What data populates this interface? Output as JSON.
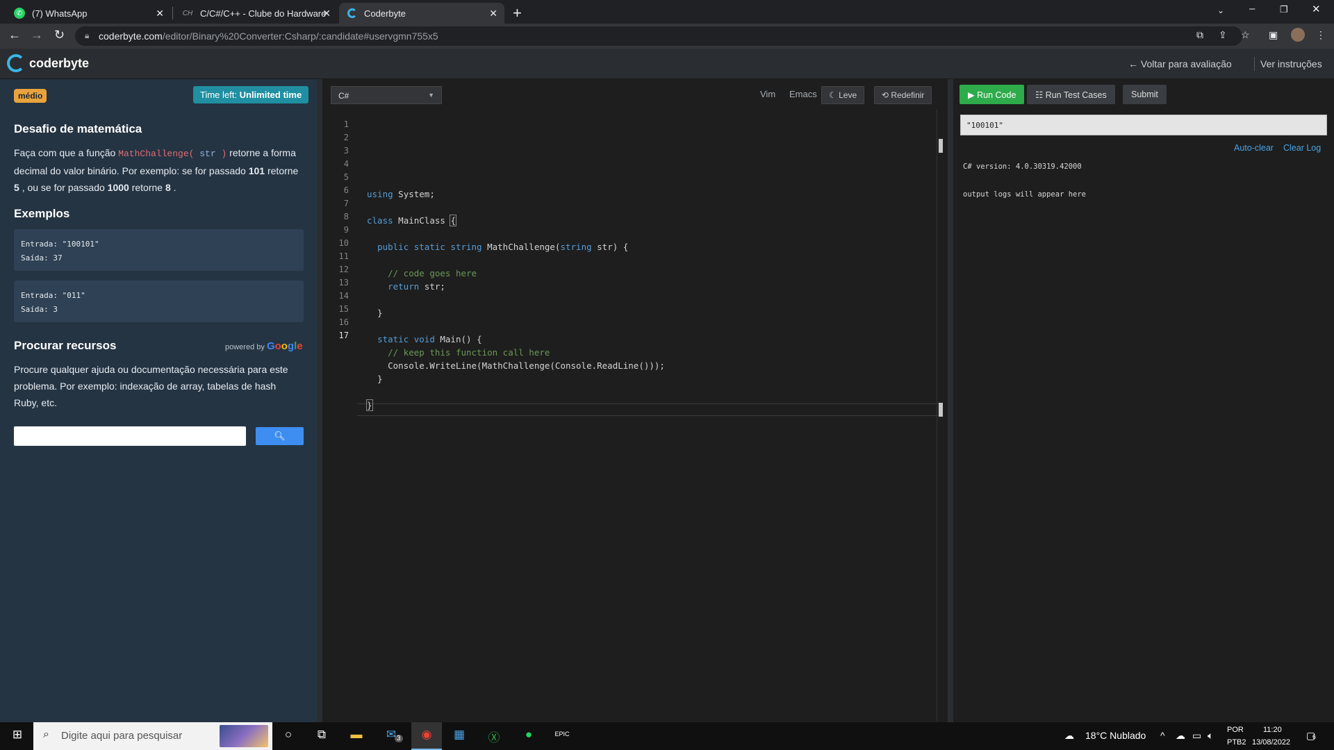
{
  "browser": {
    "tabs": [
      {
        "label": "(7) WhatsApp",
        "icon": "whatsapp-icon",
        "active": false
      },
      {
        "label": "C/C#/C++ - Clube do Hardware",
        "icon": "clube-hardware-icon",
        "active": false
      },
      {
        "label": "Coderbyte",
        "icon": "coderbyte-icon",
        "active": true
      }
    ],
    "url_host": "coderbyte.com",
    "url_path": "/editor/Binary%20Converter:Csharp/:candidate#uservgmn755x5"
  },
  "header": {
    "brand": "coderbyte",
    "back_link": "← Voltar para avaliação",
    "instructions_link": "Ver instruções"
  },
  "left": {
    "difficulty": "médio",
    "time_left_label": "Time left:",
    "time_left_value": "Unlimited time",
    "title": "Desafio de matemática",
    "desc_1": "Faça com que a função",
    "func_name": "MathChallenge(",
    "func_arg": "str",
    "func_close": ")",
    "desc_2": "retorne a",
    "desc_3": "forma decimal do valor binário. Por exemplo: se for passado",
    "ex_in_1": "101",
    "desc_4": "retorne",
    "ex_out_1": "5",
    "desc_5": ", ou se for passado",
    "ex_in_2": "1000",
    "desc_6": "retorne",
    "ex_out_2": "8",
    "desc_7": ".",
    "examples_title": "Exemplos",
    "examples": [
      {
        "input": "Entrada: \"100101\"",
        "output": "Saída: 37"
      },
      {
        "input": "Entrada: \"011\"",
        "output": "Saída: 3"
      }
    ],
    "resources_title": "Procurar recursos",
    "powered_by": "powered by",
    "google": "Google",
    "resources_text_1": "Procure qualquer ajuda ou documentação necessária para este",
    "resources_text_2": "problema. Por exemplo: indexação de array, tabelas de hash",
    "resources_text_3": "Ruby, etc.",
    "search_value": ""
  },
  "editor": {
    "language": "C#",
    "vim": "Vim",
    "emacs": "Emacs",
    "theme_button": "Leve",
    "reset_button": "Redefinir",
    "current_line": 17,
    "lines": [
      "1",
      "2",
      "3",
      "4",
      "5",
      "6",
      "7",
      "8",
      "9",
      "10",
      "11",
      "12",
      "13",
      "14",
      "15",
      "16",
      "17"
    ]
  },
  "output": {
    "run_code": "Run Code",
    "run_tests": "Run Test Cases",
    "submit": "Submit",
    "input_value": "\"100101\"",
    "auto_clear": "Auto-clear",
    "clear_log": "Clear Log",
    "version": "C# version: 4.0.30319.42000",
    "placeholder_log": "output logs will appear here"
  },
  "taskbar": {
    "search_placeholder": "Digite aqui para pesquisar",
    "mail_badge": "3",
    "weather": "18°C  Nublado",
    "lang_1": "POR",
    "lang_2": "PTB2",
    "time": "11:20",
    "date": "13/08/2022",
    "notifications": "6"
  },
  "colors": {
    "accent_green": "#2eab4a",
    "accent_teal": "#1f8fa1",
    "badge_orange": "#e8a33d",
    "panel_blue": "#253443"
  }
}
